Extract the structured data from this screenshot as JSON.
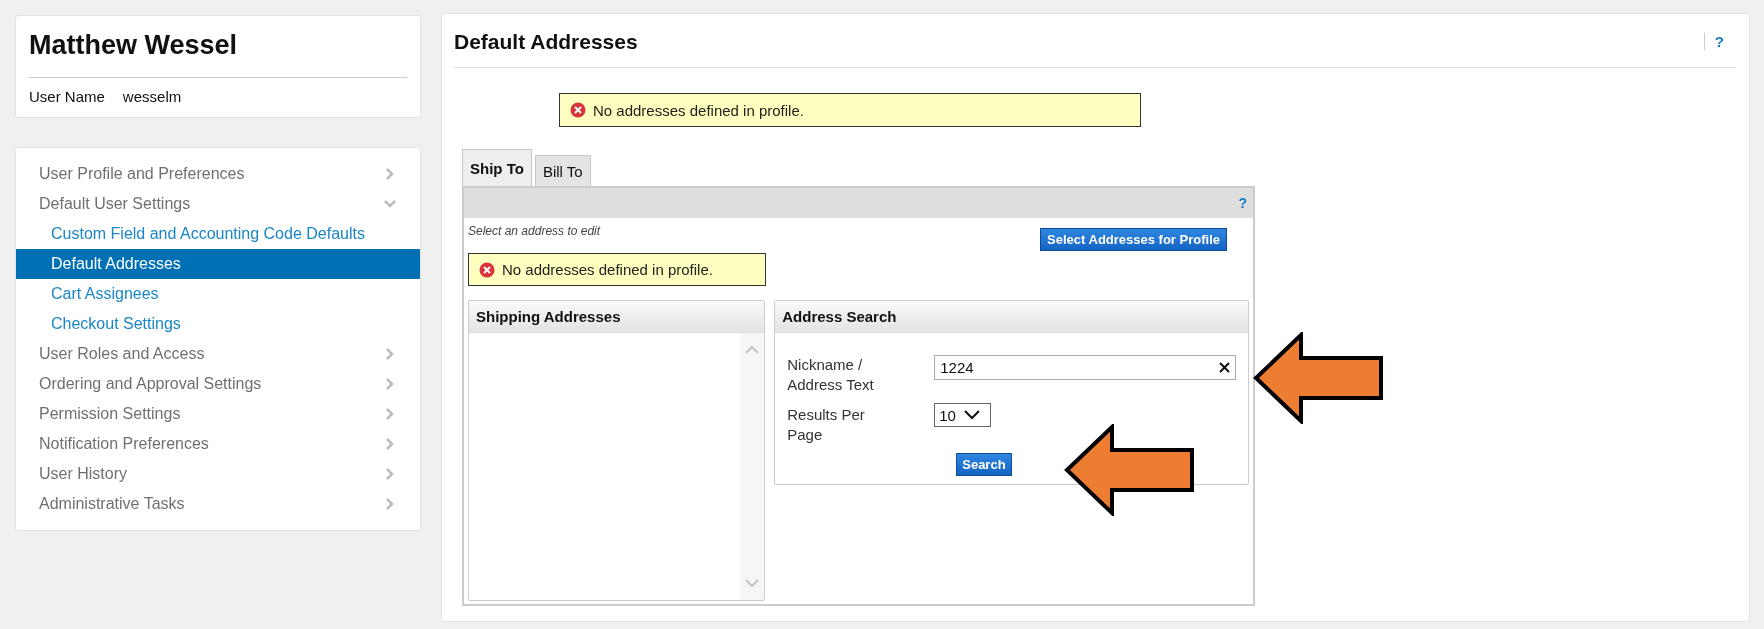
{
  "profile": {
    "name": "Matthew Wessel",
    "user_name_label": "User Name",
    "user_name": "wesselm"
  },
  "nav": [
    {
      "label": "User Profile and Preferences",
      "expanded": false
    },
    {
      "label": "Default User Settings",
      "expanded": true,
      "children": [
        {
          "label": "Custom Field and Accounting Code Defaults",
          "selected": false
        },
        {
          "label": "Default Addresses",
          "selected": true
        },
        {
          "label": "Cart Assignees",
          "selected": false
        },
        {
          "label": "Checkout Settings",
          "selected": false
        }
      ]
    },
    {
      "label": "User Roles and Access",
      "expanded": false
    },
    {
      "label": "Ordering and Approval Settings",
      "expanded": false
    },
    {
      "label": "Permission Settings",
      "expanded": false
    },
    {
      "label": "Notification Preferences",
      "expanded": false
    },
    {
      "label": "User History",
      "expanded": false
    },
    {
      "label": "Administrative Tasks",
      "expanded": false
    }
  ],
  "page": {
    "title": "Default Addresses",
    "help": "?"
  },
  "message": "No addresses defined in profile.",
  "tabs": [
    {
      "label": "Ship To",
      "selected": true
    },
    {
      "label": "Bill To",
      "selected": false
    }
  ],
  "tab_panel": {
    "help": "?",
    "hint": "Select an address to edit",
    "select_button": "Select Addresses for Profile",
    "message": "No addresses defined in profile.",
    "shipping_addresses": {
      "title": "Shipping Addresses"
    },
    "address_search": {
      "title": "Address Search",
      "nickname_label": "Nickname / Address Text",
      "nickname_value": "1224",
      "results_label": "Results Per Page",
      "results_value": "10",
      "search_button": "Search"
    }
  }
}
